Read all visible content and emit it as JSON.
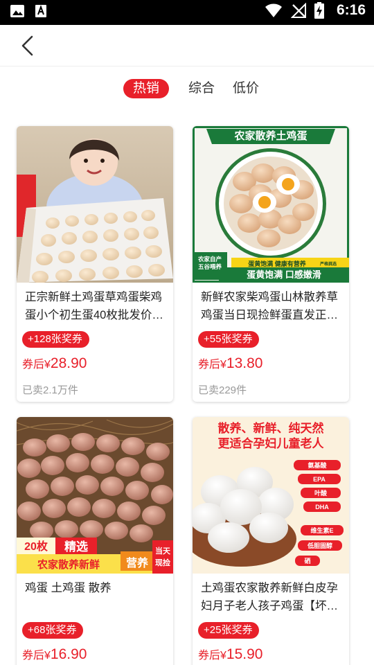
{
  "status_bar": {
    "time": "6:16"
  },
  "tabs": [
    {
      "label": "热销",
      "active": true
    },
    {
      "label": "综合",
      "active": false
    },
    {
      "label": "低价",
      "active": false
    }
  ],
  "products": [
    {
      "title": "正宗新鲜土鸡蛋草鸡蛋柴鸡蛋小个初生蛋40枚批发价…",
      "coupon": "+128张奖券",
      "price_prefix": "券后¥",
      "price": "28.90",
      "sold": "已卖2.1万件"
    },
    {
      "title": "新鲜农家柴鸡蛋山林散养草鸡蛋当日现捡鲜蛋直发正…",
      "coupon": "+55张奖券",
      "price_prefix": "券后¥",
      "price": "13.80",
      "sold": "已卖229件",
      "image_text": {
        "banner": "农家散养土鸡蛋",
        "badge_line1": "农家自产",
        "badge_line2": "五谷喂养",
        "tag": "蛋黄饱满 健康有营养",
        "tag_note": "严格挑选",
        "footer": "蛋黄饱满 口感嫩滑"
      }
    },
    {
      "title": "鸡蛋 土鸡蛋 散养",
      "coupon": "+68张奖券",
      "price_prefix": "券后¥",
      "price": "16.90",
      "image_text": {
        "count": "20枚",
        "select": "精选",
        "line": "农家散养新鲜",
        "nutrition": "营养",
        "today1": "当天",
        "today2": "现捡"
      }
    },
    {
      "title": "土鸡蛋农家散养新鲜白皮孕妇月子老人孩子鸡蛋【坏…",
      "coupon": "+25张奖券",
      "price_prefix": "券后¥",
      "price": "15.90",
      "image_text": {
        "headline1": "散养、新鲜、纯天然",
        "headline2": "更适合孕妇儿童老人",
        "nutrients": [
          "氨基酸",
          "EPA",
          "叶酸",
          "DHA",
          "维生素E",
          "低胆固醇",
          "硒"
        ]
      }
    }
  ],
  "colors": {
    "accent": "#e8202a",
    "statusbar": "#000000",
    "muted": "#999999",
    "banner_green": "#1a7a3a"
  }
}
